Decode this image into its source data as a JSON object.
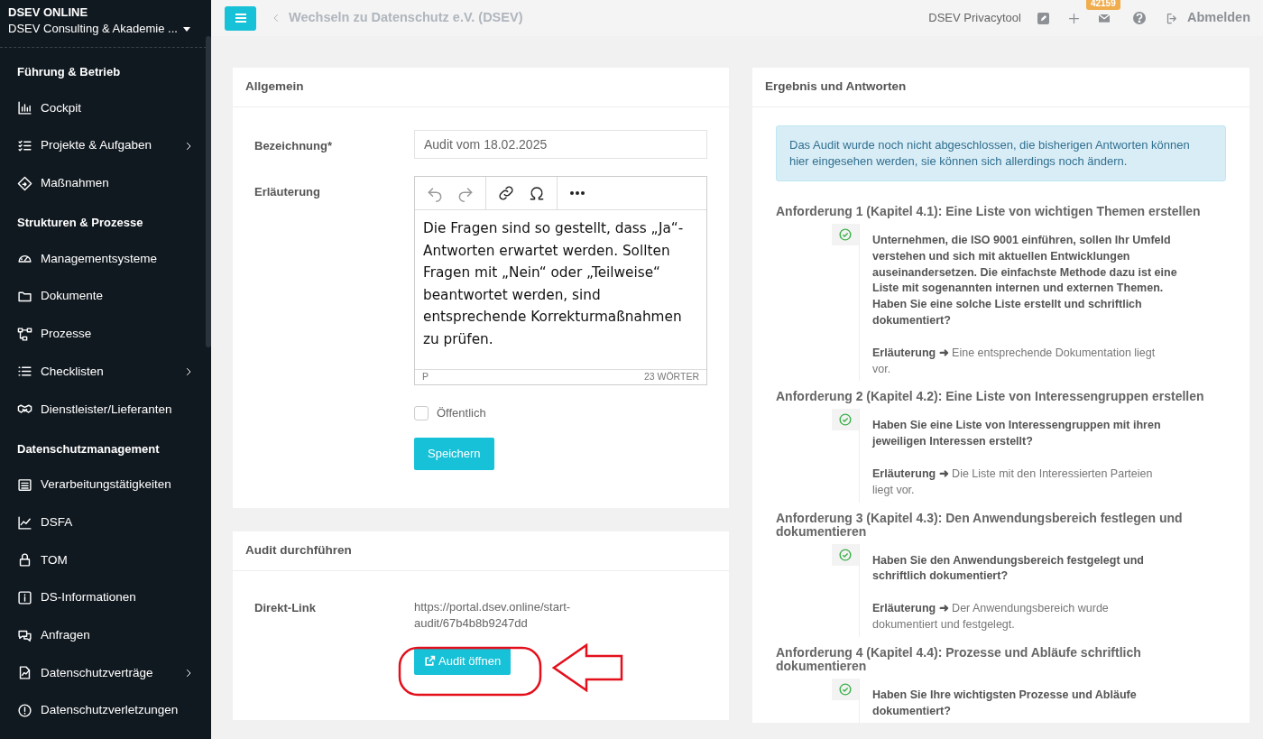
{
  "sidebar": {
    "brand": "DSEV ONLINE",
    "organization": "DSEV Consulting & Akademie ...",
    "sections": [
      {
        "title": "Führung & Betrieb",
        "items": [
          {
            "label": "Cockpit",
            "expandable": false
          },
          {
            "label": "Projekte & Aufgaben",
            "expandable": true
          },
          {
            "label": "Maßnahmen",
            "expandable": false
          }
        ]
      },
      {
        "title": "Strukturen & Prozesse",
        "items": [
          {
            "label": "Managementsysteme",
            "expandable": false
          },
          {
            "label": "Dokumente",
            "expandable": false
          },
          {
            "label": "Prozesse",
            "expandable": false
          },
          {
            "label": "Checklisten",
            "expandable": true
          },
          {
            "label": "Dienstleister/Lieferanten",
            "expandable": false
          }
        ]
      },
      {
        "title": "Datenschutzmanagement",
        "items": [
          {
            "label": "Verarbeitungstätigkeiten",
            "expandable": false
          },
          {
            "label": "DSFA",
            "expandable": false
          },
          {
            "label": "TOM",
            "expandable": false
          },
          {
            "label": "DS-Informationen",
            "expandable": false
          },
          {
            "label": "Anfragen",
            "expandable": false
          },
          {
            "label": "Datenschutzverträge",
            "expandable": true
          },
          {
            "label": "Datenschutzverletzungen",
            "expandable": false
          }
        ]
      }
    ]
  },
  "topbar": {
    "back_link": "Wechseln zu Datenschutz e.V. (DSEV)",
    "app_name": "DSEV Privacytool",
    "mail_badge": "42159",
    "logout": "Abmelden"
  },
  "general_card": {
    "title": "Allgemein",
    "name_label": "Bezeichnung*",
    "name_value": "Audit vom 18.02.2025",
    "explanation_label": "Erläuterung",
    "editor_text": "Die Fragen sind so gestellt, dass „Ja“-Antworten erwartet werden. Sollten Fragen mit „Nein“ oder „Teilweise“ beantwortet werden, sind entsprechende Korrekturmaßnahmen zu prüfen.",
    "editor_path": "P",
    "word_count": "23 WÖRTER",
    "public_label": "Öffentlich",
    "public_checked": false,
    "save_button": "Speichern"
  },
  "run_card": {
    "title": "Audit durchführen",
    "link_label": "Direkt-Link",
    "link_value": "https://portal.dsev.online/start-audit/67b4b8b9247dd",
    "open_button": "Audit öffnen"
  },
  "results_card": {
    "title": "Ergebnis und Antworten",
    "notice": "Das Audit wurde noch nicht abgeschlossen, die bisherigen Antworten können hier eingesehen werden, sie können sich allerdings noch ändern.",
    "requirements": [
      {
        "title": "Anforderung 1 (Kapitel 4.1): Eine Liste von wichtigen Themen erstellen",
        "question": "Unternehmen, die ISO 9001 einführen, sollen Ihr Umfeld verstehen und sich mit aktuellen Entwicklungen auseinandersetzen. Die einfachste Methode dazu ist eine Liste mit sogenannten internen und externen Themen. Haben Sie eine solche Liste erstellt und schriftlich dokumentiert?",
        "explanation": "**Erläuterung ➜** Eine entsprechende Dokumentation liegt vor."
      },
      {
        "title": "Anforderung 2 (Kapitel 4.2): Eine Liste von Interessengruppen erstellen",
        "question": "Haben Sie eine Liste von Interessengruppen mit ihren jeweiligen Interessen erstellt?",
        "explanation": "**Erläuterung ➜** Die Liste mit den Interessierten Parteien liegt vor."
      },
      {
        "title": "Anforderung 3 (Kapitel 4.3): Den Anwendungsbereich festlegen und dokumentieren",
        "question": "Haben Sie den Anwendungsbereich festgelegt und schriftlich dokumentiert?",
        "explanation": "**Erläuterung ➜** Der Anwendungsbereich wurde dokumentiert und festgelegt."
      },
      {
        "title": "Anforderung 4 (Kapitel 4.4): Prozesse und Abläufe schriftlich dokumentieren",
        "question": "Haben Sie Ihre wichtigsten Prozesse und Abläufe dokumentiert?"
      }
    ]
  }
}
